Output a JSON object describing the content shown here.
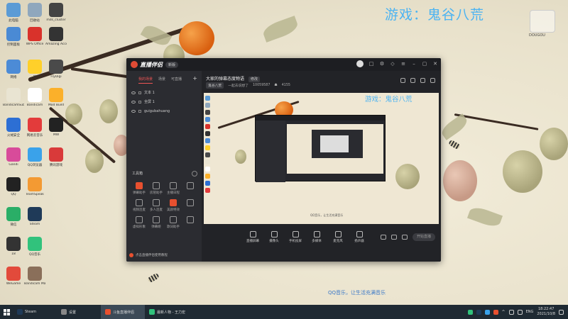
{
  "desktop": {
    "game_title": "游戏：鬼谷八荒",
    "qq_caption": "QQ音乐，让生活充满音乐",
    "corner_logo_text": "DOUGOU",
    "icons": [
      {
        "label": "此电脑",
        "color": "#5b9bd5"
      },
      {
        "label": "回收站",
        "color": "#8fa7bd"
      },
      {
        "label": "mds_cluster",
        "color": "#444444"
      },
      {
        "label": "控制面板",
        "color": "#4a8ad4"
      },
      {
        "label": "WPS Office",
        "color": "#d9322b"
      },
      {
        "label": "Amazing Accessories",
        "color": "#333333"
      },
      {
        "label": "网络",
        "color": "#4c8bd6"
      },
      {
        "label": "W",
        "color": "#ffd02a"
      },
      {
        "label": "FlyDigi",
        "color": "#4a4a4a"
      },
      {
        "label": "BandicamSub",
        "color": "#e9e4d2"
      },
      {
        "label": "Bandicam",
        "color": "#ffffff"
      },
      {
        "label": "Mod Build",
        "color": "#fbb02a"
      },
      {
        "label": "火绒安全",
        "color": "#2d6fd4"
      },
      {
        "label": "网易云音乐",
        "color": "#e33b3b"
      },
      {
        "label": "MW",
        "color": "#222222"
      },
      {
        "label": "Gandi",
        "color": "#d84b9a"
      },
      {
        "label": "QQ浏览器",
        "color": "#3aa2ea"
      },
      {
        "label": "腾讯游戏",
        "color": "#d93a3a"
      },
      {
        "label": "QQ",
        "color": "#222222"
      },
      {
        "label": "TeamSpeak",
        "color": "#f39a33"
      },
      {
        "label": "微信",
        "color": "#2aae67"
      },
      {
        "label": "Steam",
        "color": "#1f3a58"
      },
      {
        "label": "18",
        "color": "#333333"
      },
      {
        "label": "QQ音乐",
        "color": "#31c27c"
      },
      {
        "label": "WeGame",
        "color": "#e24a3b"
      },
      {
        "label": "Bandicam Manager",
        "color": "#8a6f5a"
      }
    ]
  },
  "app": {
    "name": "直播伴侣",
    "version_badge": "新版",
    "scene_tabs": [
      "我的场景",
      "场景",
      "可直播"
    ],
    "sources": [
      "文本 1",
      "全屏 1",
      "guigubahuang"
    ],
    "toolbox_title": "工具箱",
    "tools": [
      {
        "label": "弹幕助手",
        "highlight": true
      },
      {
        "label": "房管助手",
        "highlight": false
      },
      {
        "label": "主播日程",
        "highlight": false
      },
      {
        "label": "",
        "highlight": false
      },
      {
        "label": "视频连麦",
        "highlight": false
      },
      {
        "label": "多人连麦",
        "highlight": false
      },
      {
        "label": "美颜特效",
        "highlight": true
      },
      {
        "label": "",
        "highlight": false
      },
      {
        "label": "虚拟形象",
        "highlight": false
      },
      {
        "label": "弹幕姬",
        "highlight": false
      },
      {
        "label": "歌词助手",
        "highlight": false
      },
      {
        "label": "",
        "highlight": false
      }
    ],
    "notice": "点击直播伴侣使用教程",
    "room_title": "大家的弹幕态度物语",
    "room_edit": "修改",
    "room_meta": {
      "tag": "鬼谷八荒",
      "host": "一起去说想了",
      "room_id": "10059587",
      "fans": "4155"
    },
    "preview_title": "游戏：鬼谷八荒",
    "preview_caption": "QQ音乐，让生活充满音乐",
    "controls": [
      "直播屏幕",
      "摄像头",
      "手机投屏",
      "多媒体",
      "麦克风",
      "扬声器"
    ],
    "start_label": "开始直播"
  },
  "taskbar": {
    "tasks": [
      {
        "label": "Steam",
        "color": "#1f3a58",
        "active": false
      },
      {
        "label": "设置",
        "color": "#888888",
        "active": false
      },
      {
        "label": "斗鱼直播伴侣",
        "color": "#e8502f",
        "active": true
      },
      {
        "label": "最新人物 - 王力宏",
        "color": "#31c27c",
        "active": false
      }
    ],
    "lang": "ENG",
    "time": "18:22:47",
    "date": "2021/10/8"
  }
}
